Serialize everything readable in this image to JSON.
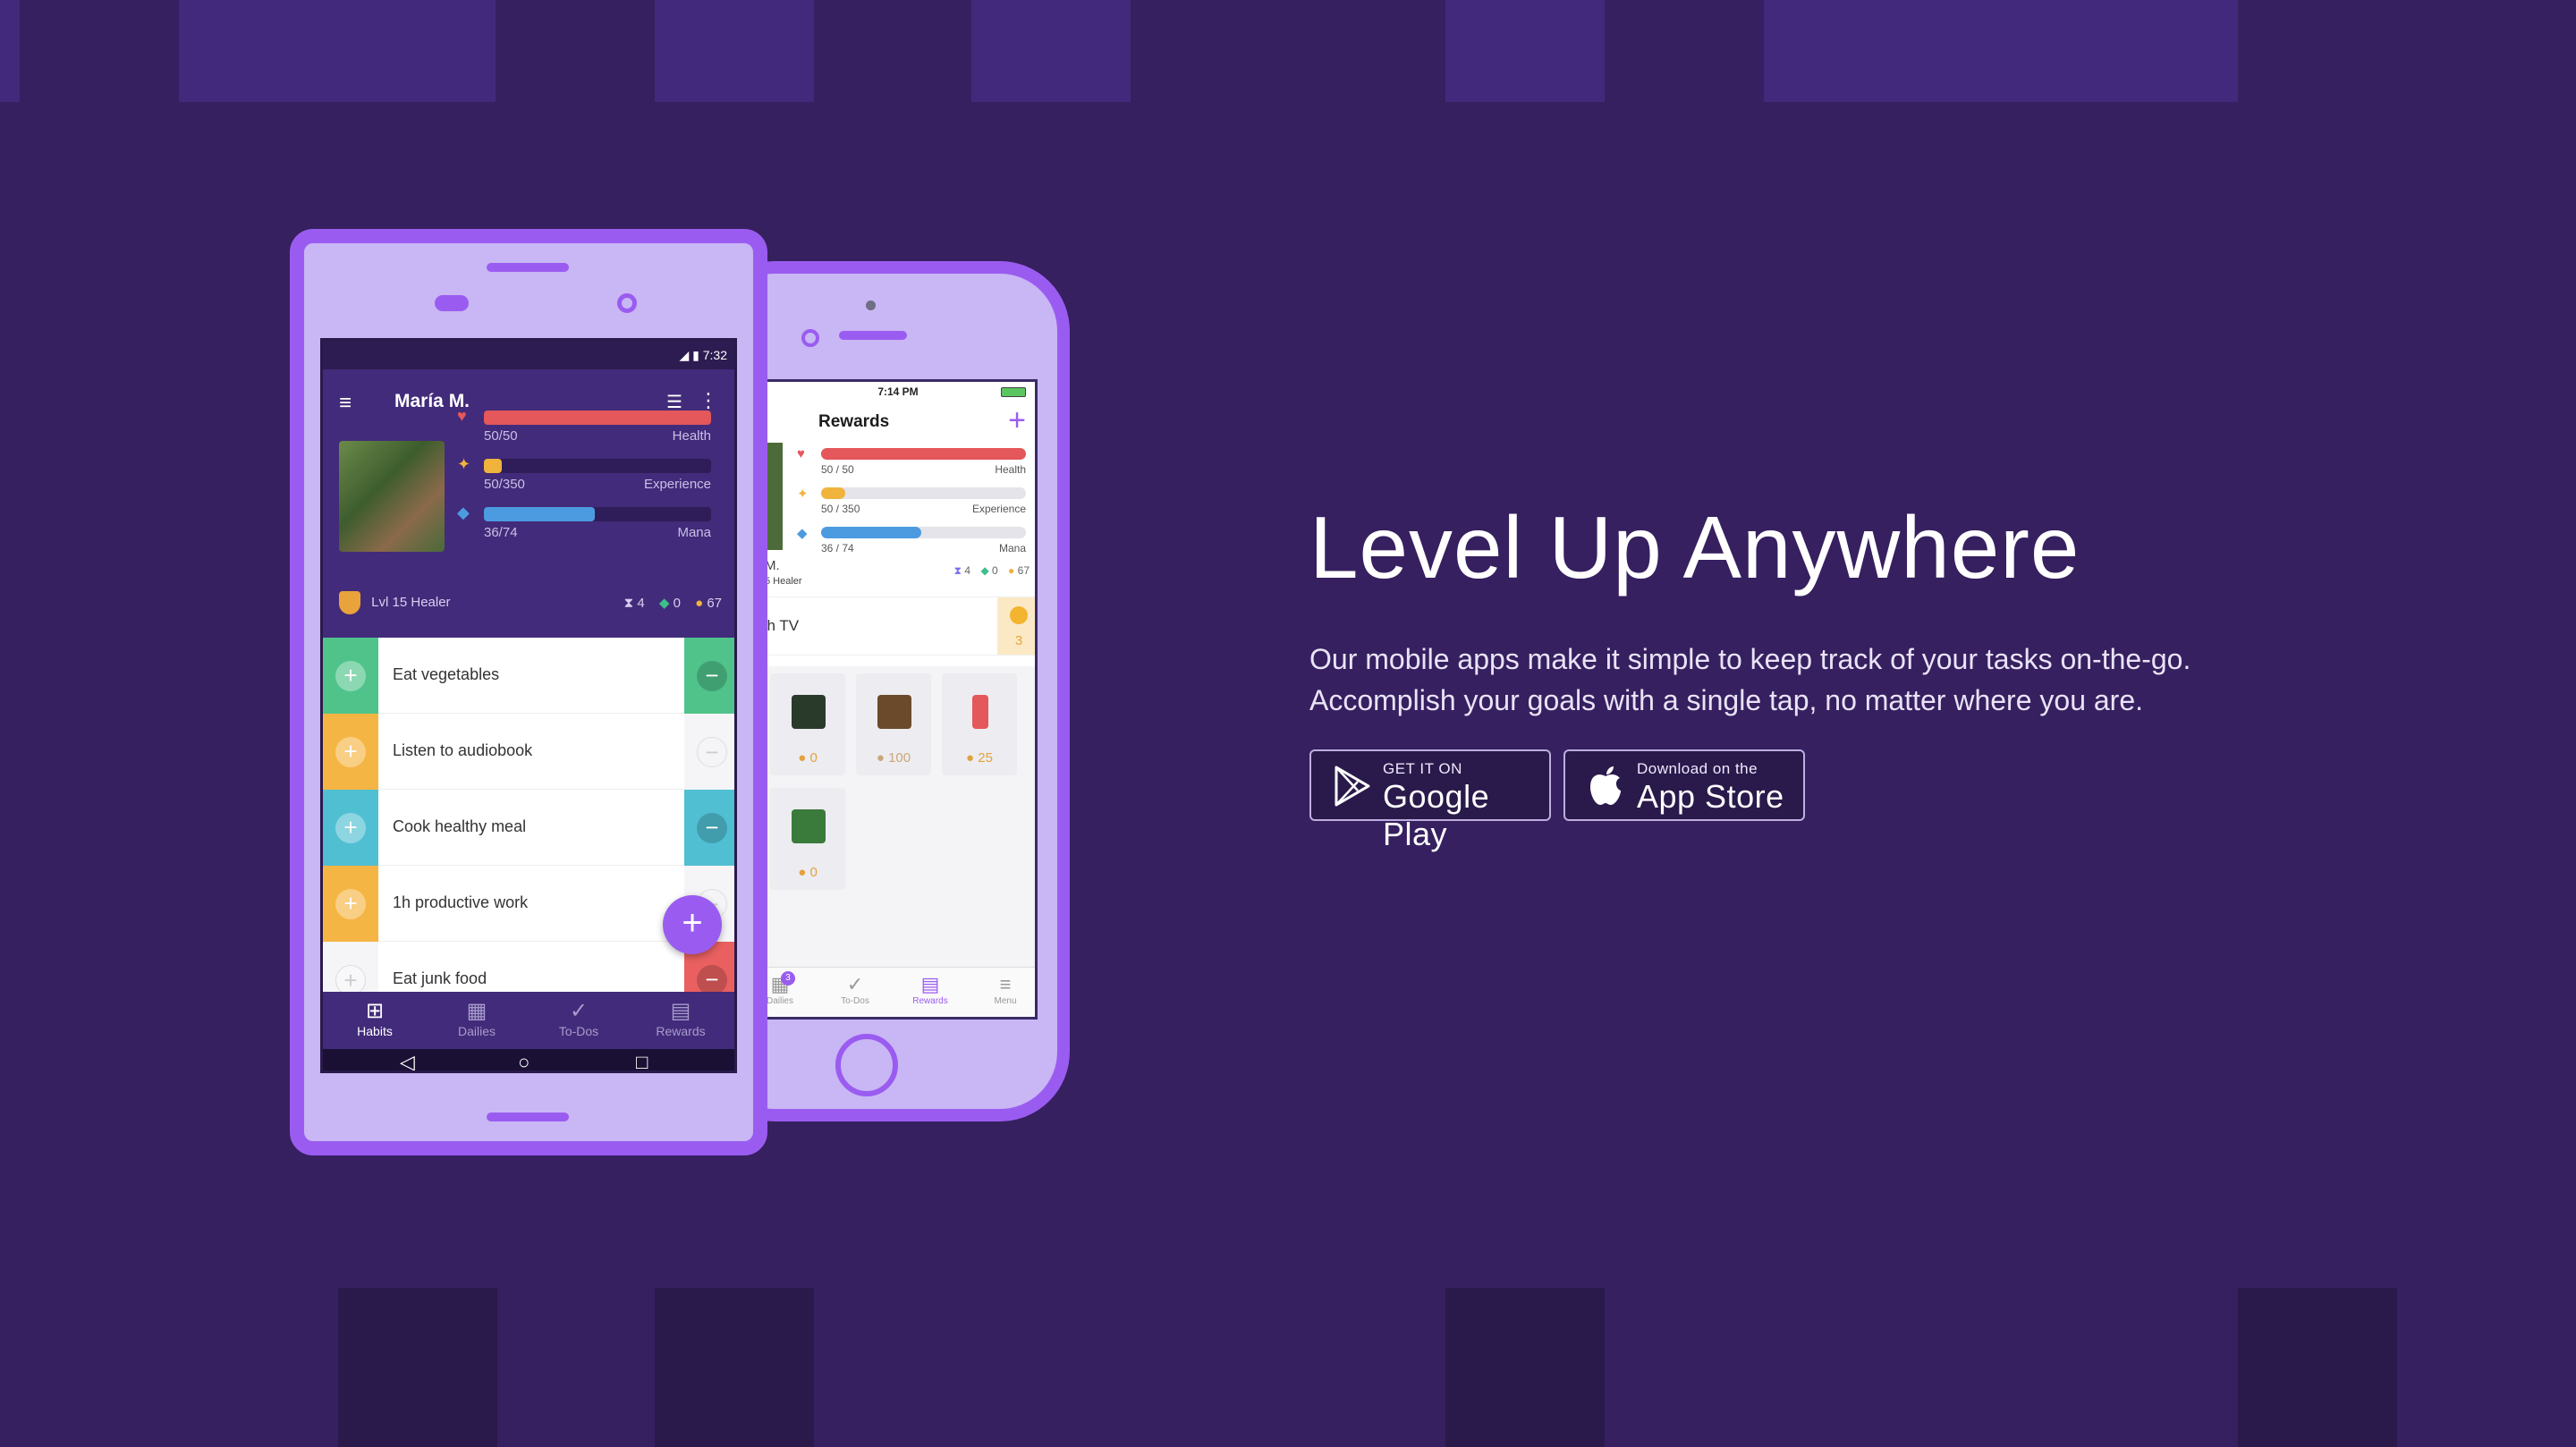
{
  "colors": {
    "background": "#36205f",
    "accent": "#9a5cf0",
    "phone_body": "#c9b6f4"
  },
  "hero": {
    "headline": "Level Up Anywhere",
    "line1": "Our mobile apps make it simple to keep track of your tasks on-the-go.",
    "line2": "Accomplish your goals with a single tap, no matter where you are."
  },
  "google_play": {
    "small": "GET IT ON",
    "big": "Google Play",
    "icon": "play-triangle-icon"
  },
  "app_store": {
    "small": "Download on the",
    "big": "App Store",
    "icon": "apple-icon"
  },
  "android": {
    "status_time": "7:32",
    "user": "María M.",
    "health": {
      "text": "50/50",
      "label": "Health",
      "fraction": 1.0
    },
    "experience": {
      "text": "50/350",
      "label": "Experience",
      "fraction": 0.08
    },
    "mana": {
      "text": "36/74",
      "label": "Mana",
      "fraction": 0.49
    },
    "level": "Lvl 15 Healer",
    "hourglass": "4",
    "gems": "0",
    "gold": "67",
    "habits": [
      {
        "text": "Eat vegetables"
      },
      {
        "text": "Listen to audiobook"
      },
      {
        "text": "Cook healthy meal"
      },
      {
        "text": "1h productive work"
      },
      {
        "text": "Eat junk food"
      }
    ],
    "tabs": [
      "Habits",
      "Dailies",
      "To-Dos",
      "Rewards"
    ]
  },
  "ios": {
    "status_time": "7:14 PM",
    "title": "Rewards",
    "health": {
      "text": "50 / 50",
      "label": "Health",
      "fraction": 1.0
    },
    "experience": {
      "text": "50 / 350",
      "label": "Experience",
      "fraction": 0.12
    },
    "mana": {
      "text": "36 / 74",
      "label": "Mana",
      "fraction": 0.49
    },
    "name_partial": "M.",
    "class_partial": "5 Healer",
    "hourglass": "4",
    "gems": "0",
    "gold": "67",
    "reward_partial": "ch TV",
    "reward_price": "3",
    "shop_prices": [
      "0",
      "100",
      "25",
      "0"
    ],
    "tabs": [
      "Dailies",
      "To-Dos",
      "Rewards",
      "Menu"
    ],
    "dailies_badge": "3"
  }
}
